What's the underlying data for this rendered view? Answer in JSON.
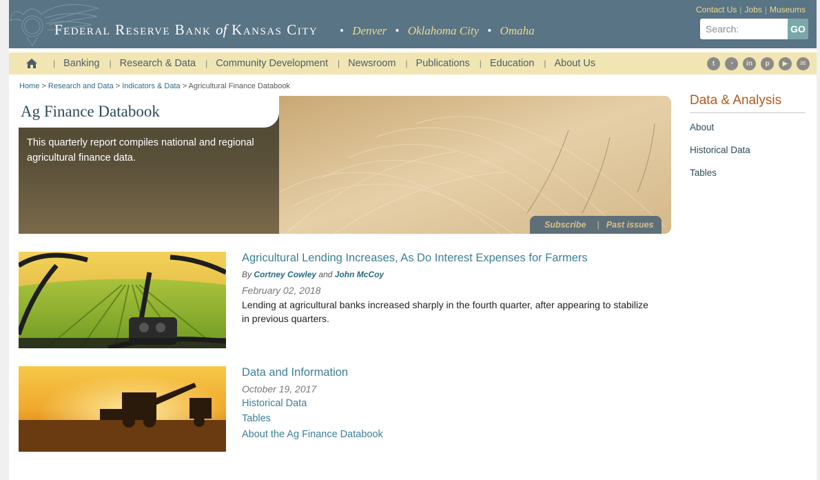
{
  "header": {
    "bank_name_part1": "Federal Reserve Bank",
    "bank_name_of": "of",
    "bank_name_part2": "Kansas City",
    "branches": [
      "Denver",
      "Oklahoma City",
      "Omaha"
    ],
    "utility_links": [
      "Contact Us",
      "Jobs",
      "Museums"
    ],
    "search_placeholder": "Search:",
    "search_button": "GO"
  },
  "nav": {
    "home_icon": "home-icon",
    "items": [
      "Banking",
      "Research & Data",
      "Community Development",
      "Newsroom",
      "Publications",
      "Education",
      "About Us"
    ],
    "social_icons": [
      "twitter-icon",
      "rss-icon",
      "linkedin-icon",
      "pinterest-icon",
      "youtube-icon",
      "email-icon"
    ]
  },
  "breadcrumb": {
    "items": [
      "Home",
      "Research and Data",
      "Indicators & Data"
    ],
    "separator": ">",
    "current": "Agricultural Finance Databook"
  },
  "hero": {
    "title": "Ag Finance Databook",
    "description": "This quarterly report compiles national and regional agricultural finance data.",
    "tab_subscribe": "Subscribe",
    "tab_past": "Past issues"
  },
  "sidebar": {
    "title": "Data & Analysis",
    "links": [
      "About",
      "Historical Data",
      "Tables"
    ]
  },
  "articles": [
    {
      "title": "Agricultural Lending Increases, As Do Interest Expenses for Farmers",
      "by": "By",
      "author1": "Cortney Cowley",
      "and": "and",
      "author2": "John McCoy",
      "date": "February 02, 2018",
      "summary": "Lending at agricultural banks increased sharply in the fourth quarter, after appearing to stabilize in previous quarters."
    },
    {
      "title": "Data and Information",
      "date": "October 19, 2017",
      "links": [
        "Historical Data",
        "Tables",
        "About the Ag Finance Databook"
      ]
    }
  ],
  "colors": {
    "header_bg": "#587485",
    "nav_bg": "#f1e5b3",
    "accent_gold": "#f1d98a",
    "link_teal": "#3d7f98",
    "sidebar_title": "#b05a1d"
  }
}
